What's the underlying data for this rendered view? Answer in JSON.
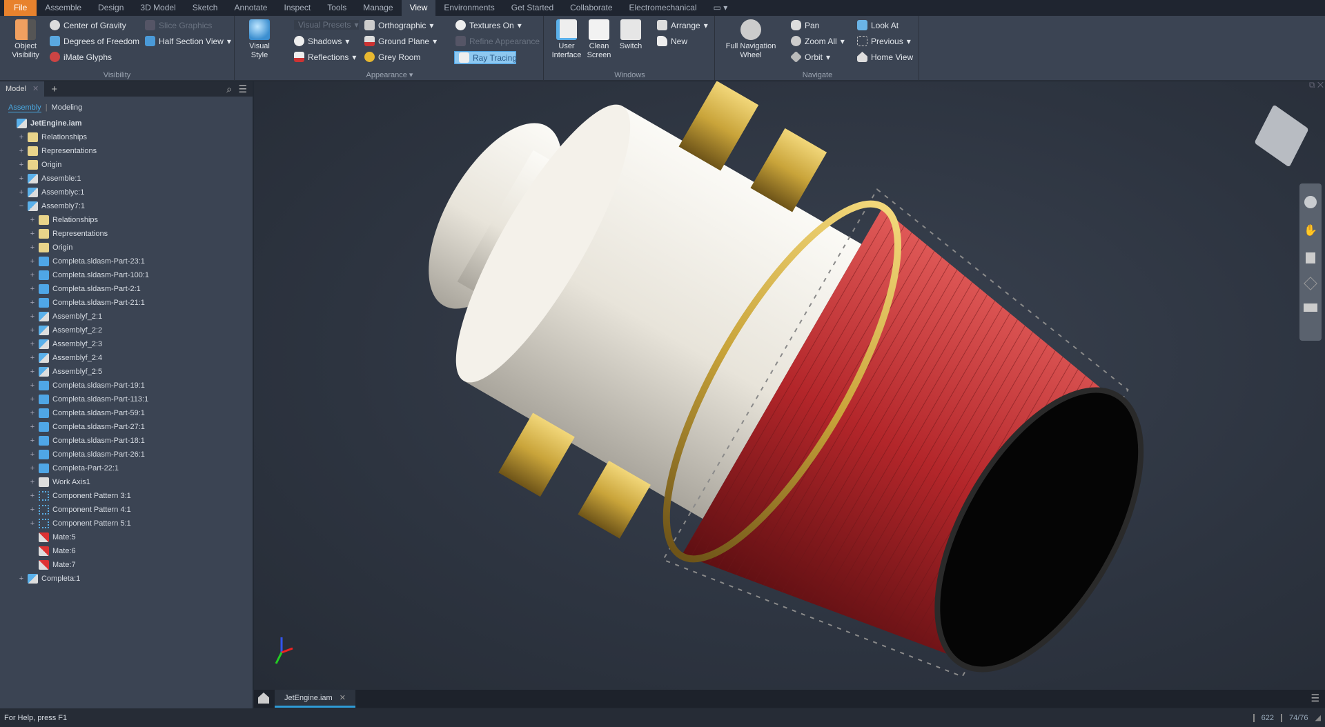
{
  "ribbon_tabs": [
    "File",
    "Assemble",
    "Design",
    "3D Model",
    "Sketch",
    "Annotate",
    "Inspect",
    "Tools",
    "Manage",
    "View",
    "Environments",
    "Get Started",
    "Collaborate",
    "Electromechanical"
  ],
  "active_tab": "View",
  "visibility": {
    "title": "Visibility",
    "object_visibility": "Object Visibility",
    "center_of_gravity": "Center of Gravity",
    "degrees_of_freedom": "Degrees of Freedom",
    "imate_glyphs": "iMate Glyphs",
    "slice_graphics": "Slice Graphics",
    "half_section_view": "Half Section View"
  },
  "appearance": {
    "title": "Appearance",
    "visual_style": "Visual Style",
    "visual_presets": "Visual Presets",
    "shadows": "Shadows",
    "reflections": "Reflections",
    "orthographic": "Orthographic",
    "ground_plane": "Ground Plane",
    "grey_room": "Grey Room",
    "textures_on": "Textures On",
    "refine_appearance": "Refine Appearance",
    "ray_tracing": "Ray Tracing"
  },
  "windows": {
    "title": "Windows",
    "user_interface": "User Interface",
    "clean_screen": "Clean Screen",
    "switch": "Switch",
    "arrange": "Arrange",
    "new": "New"
  },
  "navigate": {
    "title": "Navigate",
    "full_navigation_wheel": "Full Navigation Wheel",
    "pan": "Pan",
    "zoom_all": "Zoom All",
    "orbit": "Orbit",
    "look_at": "Look At",
    "previous": "Previous",
    "home_view": "Home View"
  },
  "browser": {
    "tab": "Model",
    "add": "+",
    "subtab_assembly": "Assembly",
    "subtab_modeling": "Modeling",
    "tree": [
      {
        "label": "JetEngine.iam",
        "level": 0,
        "icon": "assembly",
        "exp": ""
      },
      {
        "label": "Relationships",
        "level": 1,
        "icon": "folder",
        "exp": "+"
      },
      {
        "label": "Representations",
        "level": 1,
        "icon": "folder",
        "exp": "+"
      },
      {
        "label": "Origin",
        "level": 1,
        "icon": "folder",
        "exp": "+"
      },
      {
        "label": "Assemble:1",
        "level": 1,
        "icon": "assembly",
        "exp": "+"
      },
      {
        "label": "Assemblyc:1",
        "level": 1,
        "icon": "assembly",
        "exp": "+"
      },
      {
        "label": "Assembly7:1",
        "level": 1,
        "icon": "assembly",
        "exp": "−"
      },
      {
        "label": "Relationships",
        "level": 2,
        "icon": "folder",
        "exp": "+"
      },
      {
        "label": "Representations",
        "level": 2,
        "icon": "folder",
        "exp": "+"
      },
      {
        "label": "Origin",
        "level": 2,
        "icon": "folder",
        "exp": "+"
      },
      {
        "label": "Completa.sldasm-Part-23:1",
        "level": 2,
        "icon": "part",
        "exp": "+"
      },
      {
        "label": "Completa.sldasm-Part-100:1",
        "level": 2,
        "icon": "part",
        "exp": "+"
      },
      {
        "label": "Completa.sldasm-Part-2:1",
        "level": 2,
        "icon": "part",
        "exp": "+"
      },
      {
        "label": "Completa.sldasm-Part-21:1",
        "level": 2,
        "icon": "part",
        "exp": "+"
      },
      {
        "label": "Assemblyf_2:1",
        "level": 2,
        "icon": "assembly",
        "exp": "+"
      },
      {
        "label": "Assemblyf_2:2",
        "level": 2,
        "icon": "assembly",
        "exp": "+"
      },
      {
        "label": "Assemblyf_2:3",
        "level": 2,
        "icon": "assembly",
        "exp": "+"
      },
      {
        "label": "Assemblyf_2:4",
        "level": 2,
        "icon": "assembly",
        "exp": "+"
      },
      {
        "label": "Assemblyf_2:5",
        "level": 2,
        "icon": "assembly",
        "exp": "+"
      },
      {
        "label": "Completa.sldasm-Part-19:1",
        "level": 2,
        "icon": "part",
        "exp": "+"
      },
      {
        "label": "Completa.sldasm-Part-113:1",
        "level": 2,
        "icon": "part",
        "exp": "+"
      },
      {
        "label": "Completa.sldasm-Part-59:1",
        "level": 2,
        "icon": "part",
        "exp": "+"
      },
      {
        "label": "Completa.sldasm-Part-27:1",
        "level": 2,
        "icon": "part",
        "exp": "+"
      },
      {
        "label": "Completa.sldasm-Part-18:1",
        "level": 2,
        "icon": "part",
        "exp": "+"
      },
      {
        "label": "Completa.sldasm-Part-26:1",
        "level": 2,
        "icon": "part",
        "exp": "+"
      },
      {
        "label": "Completa-Part-22:1",
        "level": 2,
        "icon": "part",
        "exp": "+"
      },
      {
        "label": "Work Axis1",
        "level": 2,
        "icon": "axis",
        "exp": "+"
      },
      {
        "label": "Component Pattern 3:1",
        "level": 2,
        "icon": "pattern",
        "exp": "+"
      },
      {
        "label": "Component Pattern 4:1",
        "level": 2,
        "icon": "pattern",
        "exp": "+"
      },
      {
        "label": "Component Pattern 5:1",
        "level": 2,
        "icon": "pattern",
        "exp": "+"
      },
      {
        "label": "Mate:5",
        "level": 2,
        "icon": "mate",
        "exp": ""
      },
      {
        "label": "Mate:6",
        "level": 2,
        "icon": "mate",
        "exp": ""
      },
      {
        "label": "Mate:7",
        "level": 2,
        "icon": "mate",
        "exp": ""
      },
      {
        "label": "Completa:1",
        "level": 1,
        "icon": "assembly",
        "exp": "+"
      }
    ]
  },
  "document_tab": "JetEngine.iam",
  "status": {
    "help": "For Help, press F1",
    "count1": "622",
    "count2": "74/76"
  },
  "colors": {
    "accent": "#2e9bd6",
    "file_tab": "#e8822d",
    "nozzle": "#b3262a",
    "gold": "#c9a43a",
    "body": "#eeeae2"
  }
}
